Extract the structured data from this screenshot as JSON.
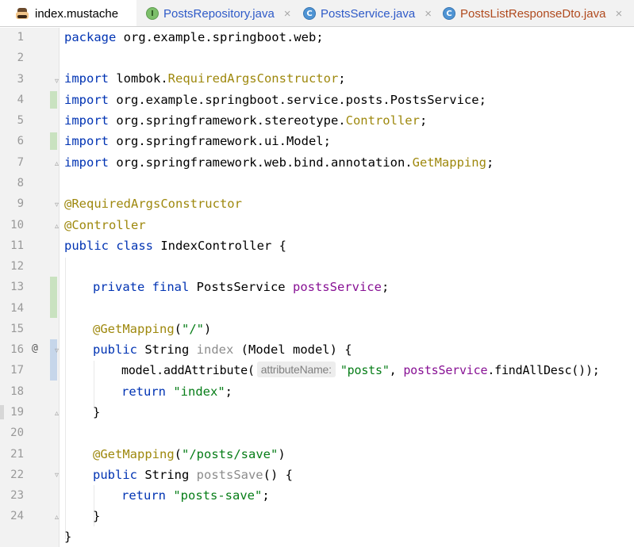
{
  "tabs": [
    {
      "label": "index.mustache",
      "icon": "mustache-file-icon",
      "active": true
    },
    {
      "label": "PostsRepository.java",
      "icon": "interface-icon",
      "icon_letter": "I",
      "active": false
    },
    {
      "label": "PostsService.java",
      "icon": "class-icon",
      "icon_letter": "C",
      "active": false
    },
    {
      "label": "PostsListResponseDto.java",
      "icon": "class-icon",
      "icon_letter": "C",
      "active": false
    }
  ],
  "close_glyph": "×",
  "gutter": {
    "line_numbers": [
      "1",
      "2",
      "3",
      "4",
      "5",
      "6",
      "7",
      "8",
      "9",
      "10",
      "11",
      "12",
      "13",
      "14",
      "15",
      "16",
      "17",
      "18",
      "19",
      "20",
      "21",
      "22",
      "23",
      "24"
    ],
    "override_marker": "@"
  },
  "code": {
    "l1": {
      "kw": "package",
      "rest": " org.example.springboot.web;"
    },
    "l3": {
      "kw": "import",
      "pre": " lombok.",
      "ann": "RequiredArgsConstructor",
      "post": ";"
    },
    "l4": {
      "kw": "import",
      "rest": " org.example.springboot.service.posts.PostsService;"
    },
    "l5": {
      "kw": "import",
      "pre": " org.springframework.stereotype.",
      "ann": "Controller",
      "post": ";"
    },
    "l6": {
      "kw": "import",
      "rest": " org.springframework.ui.Model;"
    },
    "l7": {
      "kw": "import",
      "pre": " org.springframework.web.bind.annotation.",
      "ann": "GetMapping",
      "post": ";"
    },
    "l9": {
      "ann": "@RequiredArgsConstructor"
    },
    "l10": {
      "ann": "@Controller"
    },
    "l11": {
      "kw": "public class",
      "rest": " IndexController {"
    },
    "l13": {
      "kw": "private final",
      "pre": " PostsService ",
      "fld": "postsService",
      "post": ";"
    },
    "l15": {
      "ann": "@GetMapping",
      "pre": "(",
      "str": "\"/\"",
      "post": ")"
    },
    "l16": {
      "kw": "public",
      "pre": " String ",
      "gray": "index",
      "post": " (Model model) {"
    },
    "l17": {
      "pre": "model.addAttribute(",
      "hint": "attributeName:",
      "str": "\"posts\"",
      "mid": ", ",
      "fld": "postsService",
      "post": ".findAllDesc());"
    },
    "l18": {
      "kw": "return",
      "pre": " ",
      "str": "\"index\"",
      "post": ";"
    },
    "l19": {
      "rest": "}"
    },
    "l21": {
      "ann": "@GetMapping",
      "pre": "(",
      "str": "\"/posts/save\"",
      "post": ")"
    },
    "l22": {
      "kw": "public",
      "pre": " String ",
      "gray": "postsSave",
      "post": "() {"
    },
    "l23": {
      "kw": "return",
      "pre": " ",
      "str": "\"posts-save\"",
      "post": ";"
    },
    "l24": {
      "rest": "}"
    },
    "l25": {
      "rest": "}"
    }
  },
  "colors": {
    "keyword": "#0033b3",
    "annotation": "#9e880d",
    "string": "#067d17",
    "field": "#871094",
    "added_line_marker": "#c9e2c0",
    "modified_line_marker": "#c6d6ea"
  }
}
